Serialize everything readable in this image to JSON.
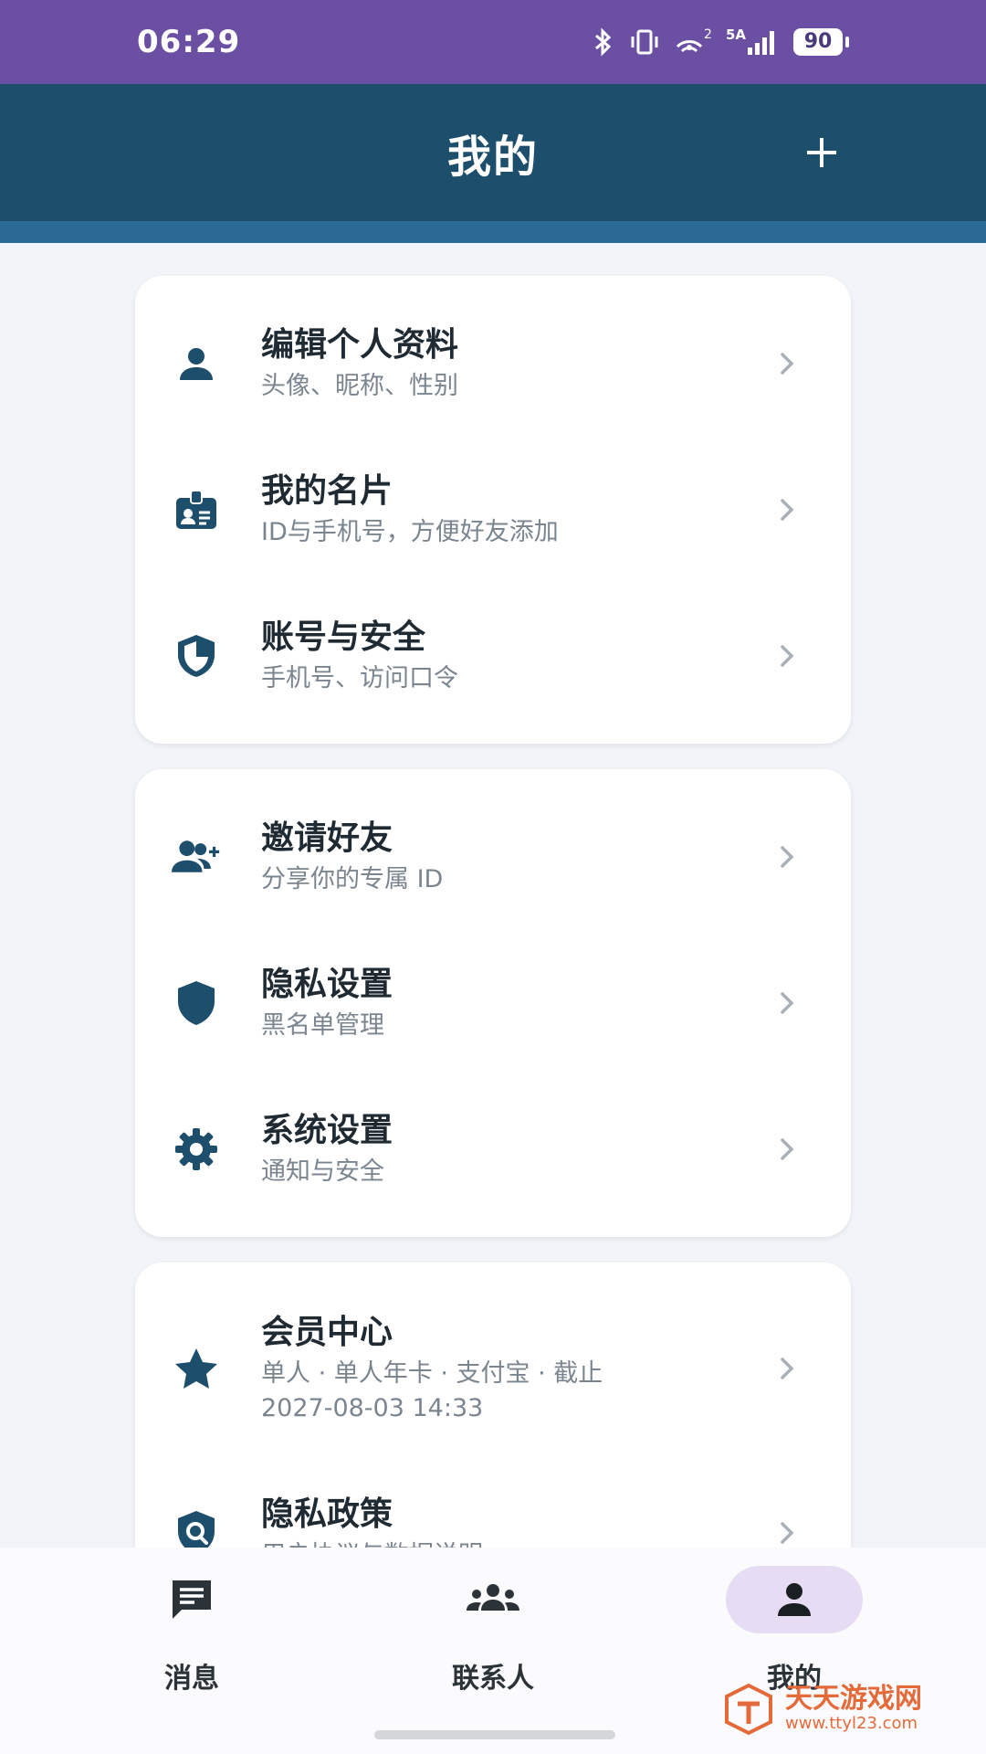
{
  "status": {
    "time": "06:29",
    "network": "5A",
    "signal_sub": "2",
    "battery": "90"
  },
  "header": {
    "title": "我的"
  },
  "cards": [
    {
      "items": [
        {
          "title": "编辑个人资料",
          "subtitle": "头像、昵称、性别",
          "icon": "person-icon"
        },
        {
          "title": "我的名片",
          "subtitle": "ID与手机号，方便好友添加",
          "icon": "badge-icon"
        },
        {
          "title": "账号与安全",
          "subtitle": "手机号、访问口令",
          "icon": "shield-check-icon"
        }
      ]
    },
    {
      "items": [
        {
          "title": "邀请好友",
          "subtitle": "分享你的专属 ID",
          "icon": "add-friend-icon"
        },
        {
          "title": "隐私设置",
          "subtitle": "黑名单管理",
          "icon": "shield-icon"
        },
        {
          "title": "系统设置",
          "subtitle": "通知与安全",
          "icon": "gear-icon"
        }
      ]
    },
    {
      "items": [
        {
          "title": "会员中心",
          "subtitle": "单人 · 单人年卡 · 支付宝 · 截止",
          "subtitle2": "2027-08-03 14:33",
          "icon": "star-icon"
        },
        {
          "title": "隐私政策",
          "subtitle": "用户协议与数据说明",
          "icon": "privacy-policy-icon"
        }
      ]
    }
  ],
  "nav": {
    "tabs": [
      {
        "label": "消息",
        "icon": "message-icon"
      },
      {
        "label": "联系人",
        "icon": "contacts-icon"
      },
      {
        "label": "我的",
        "icon": "profile-icon",
        "active": true
      }
    ]
  },
  "watermark": {
    "title": "天天游戏网",
    "url": "www.ttyl23.com"
  },
  "colors": {
    "header": "#1d4e6b",
    "status_bar": "#6a4fa3",
    "icon": "#1d4e6b",
    "active_tab_bg": "#e6dcf3"
  }
}
